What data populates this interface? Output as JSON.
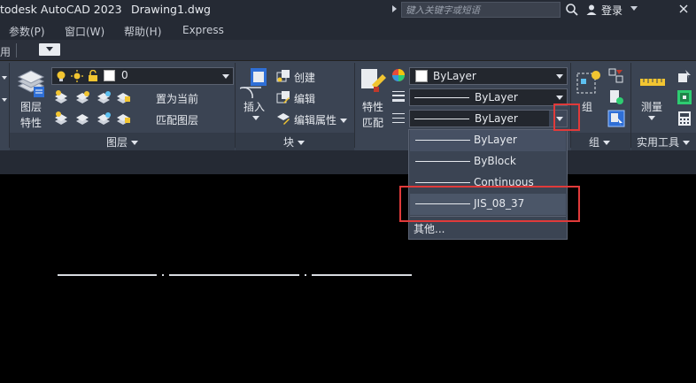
{
  "titlebar": {
    "app_title": "todesk AutoCAD 2023",
    "doc_title": "Drawing1.dwg",
    "search_placeholder": "键入关键字或短语",
    "user_label": "登录"
  },
  "menubar": {
    "items": [
      "参数(P)",
      "窗口(W)",
      "帮助(H)",
      "Express"
    ]
  },
  "tabrow": {
    "partial_tab": "用"
  },
  "ribbon": {
    "layers": {
      "layer_properties_label_1": "图层",
      "layer_properties_label_2": "特性",
      "current_layer": "0",
      "make_current": "置为当前",
      "match_layer": "匹配图层",
      "panel_title": "图层"
    },
    "block": {
      "insert_label": "插入",
      "create": "创建",
      "edit": "编辑",
      "edit_attributes": "编辑属性",
      "panel_title": "块"
    },
    "properties": {
      "match_label_1": "特性",
      "match_label_2": "匹配",
      "color_value": "ByLayer",
      "lineweight_value": "ByLayer",
      "linetype_value": "ByLayer"
    },
    "groups": {
      "group_label": "组",
      "panel_title": "组"
    },
    "utilities": {
      "measure_label": "测量",
      "panel_title": "实用工具"
    }
  },
  "linetype_dropdown": {
    "items": [
      "ByLayer",
      "ByBlock",
      "Continuous",
      "JIS_08_37"
    ],
    "other": "其他..."
  },
  "colors": {
    "highlight_box": "#e03a3a",
    "ribbon_bg": "#3b4453",
    "titlebar_bg": "#252a34"
  }
}
